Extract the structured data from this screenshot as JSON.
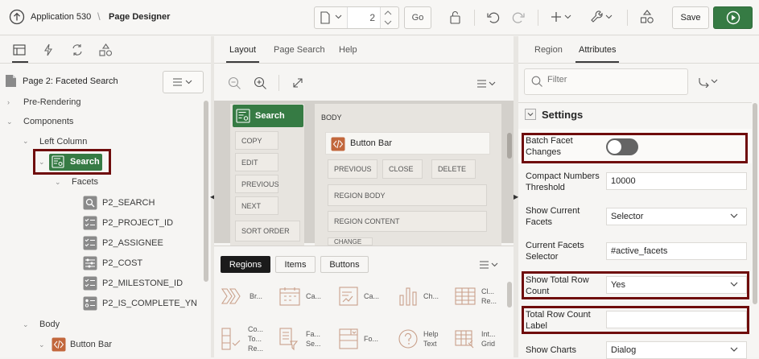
{
  "app": {
    "name": "Application 530",
    "page_designer": "Page Designer"
  },
  "toolbar": {
    "page_number": "2",
    "go_label": "Go",
    "save_label": "Save"
  },
  "left": {
    "page_label": "Page 2: Faceted Search",
    "tree": {
      "pre_rendering": "Pre-Rendering",
      "components": "Components",
      "left_column": "Left Column",
      "search": "Search",
      "facets": "Facets",
      "items": [
        "P2_SEARCH",
        "P2_PROJECT_ID",
        "P2_ASSIGNEE",
        "P2_COST",
        "P2_MILESTONE_ID",
        "P2_IS_COMPLETE_YN"
      ],
      "body": "Body",
      "button_bar": "Button Bar"
    }
  },
  "center": {
    "tabs": [
      "Layout",
      "Page Search",
      "Help"
    ],
    "left_col": {
      "region": "Search",
      "slots": [
        "COPY",
        "EDIT",
        "PREVIOUS",
        "NEXT",
        "SORT ORDER"
      ]
    },
    "body": {
      "label": "BODY",
      "region": "Button Bar",
      "buttons": [
        "PREVIOUS",
        "CLOSE",
        "DELETE"
      ],
      "slots": [
        "REGION BODY",
        "REGION CONTENT",
        "CHANGE"
      ]
    },
    "gallery": {
      "tabs": [
        "Regions",
        "Items",
        "Buttons"
      ],
      "row1": [
        "Br...",
        "Ca...",
        "Ca...",
        "Ch...",
        "Cl... Re..."
      ],
      "row2": [
        "Co... To... Re...",
        "Fa... Se...",
        "Fo...",
        "Help Text",
        "Int... Grid"
      ]
    }
  },
  "right": {
    "tabs": [
      "Region",
      "Attributes"
    ],
    "filter_placeholder": "Filter",
    "section": "Settings",
    "fields": [
      {
        "label": "Batch Facet Changes",
        "value": ""
      },
      {
        "label": "Compact Numbers Threshold",
        "value": "10000"
      },
      {
        "label": "Show Current Facets",
        "value": "Selector"
      },
      {
        "label": "Current Facets Selector",
        "value": "#active_facets"
      },
      {
        "label": "Show Total Row Count",
        "value": "Yes"
      },
      {
        "label": "Total Row Count Label",
        "value": ""
      },
      {
        "label": "Show Charts",
        "value": "Dialog"
      }
    ]
  },
  "colors": {
    "accent_green": "#367b44",
    "highlight": "#6f0c0c",
    "region_orange": "#c2673c"
  },
  "icons": [
    "arrow-up-circle-icon",
    "page-icon",
    "lock-icon",
    "undo-icon",
    "redo-icon",
    "plus-icon",
    "wrench-icon",
    "shapes-icon",
    "play-icon",
    "tree-icon",
    "lightning-icon",
    "shared-icon",
    "components-icon",
    "zoom-out-icon",
    "zoom-in-icon",
    "expand-icon",
    "menu-icon",
    "search-icon",
    "redirect-icon"
  ]
}
